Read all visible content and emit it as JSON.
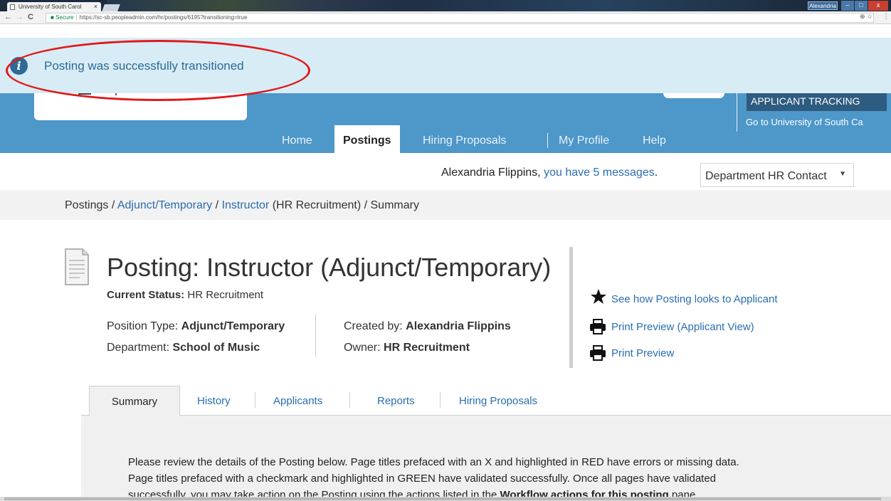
{
  "browser": {
    "tab_title": "University of South Carol",
    "tab_close": "×",
    "secure_label": "Secure",
    "url": "https://sc-sb.peopleadmin.com/hr/postings/6195?transitioning=true",
    "user_badge": "Alexandria",
    "back_glyph": "←",
    "forward_glyph": "→",
    "reload_glyph": "C",
    "lock_glyph": "🔒",
    "right_icons": "⊕ ☆",
    "menu_glyph": "⋮",
    "win_min": "–",
    "win_max": "□",
    "win_close": "x"
  },
  "notification": {
    "icon": "info-icon",
    "icon_glyph": "i",
    "message": "Posting was successfully transitioned"
  },
  "header": {
    "app_tracking": "APPLICANT TRACKING",
    "go_to_link": "Go to University of South Ca",
    "nav": [
      {
        "label": "Home"
      },
      {
        "label": "Postings"
      },
      {
        "label": "Hiring Proposals"
      },
      {
        "label": "My Profile"
      },
      {
        "label": "Help"
      }
    ],
    "active_nav": "Postings"
  },
  "user_bar": {
    "name_text": "Alexandria Flippins, ",
    "messages_link": "you have 5 messages",
    "trailing": ".",
    "role_select": "Department HR Contact",
    "caret": "▼"
  },
  "breadcrumb": {
    "root": "Postings",
    "sep": " / ",
    "level1": "Adjunct/Temporary",
    "level2": "Instructor",
    "level2_suffix": " (HR Recruitment)",
    "current": "Summary"
  },
  "posting": {
    "title": "Posting: Instructor (Adjunct/Temporary)",
    "status_label": "Current Status:",
    "status_value": " HR Recruitment",
    "position_type_label": "Position Type: ",
    "position_type_value": "Adjunct/Temporary",
    "department_label": "Department: ",
    "department_value": "School of Music",
    "created_by_label": "Created by: ",
    "created_by_value": "Alexandria Flippins",
    "owner_label": "Owner: ",
    "owner_value": "HR Recruitment"
  },
  "actions": {
    "see_applicant": "See how Posting looks to Applicant",
    "print_applicant": "Print Preview (Applicant View)",
    "print": "Print Preview",
    "star_icon": "star-icon",
    "printer_icon": "printer-icon"
  },
  "tabs": [
    {
      "label": "Summary",
      "active": true
    },
    {
      "label": "History"
    },
    {
      "label": "Applicants"
    },
    {
      "label": "Reports"
    },
    {
      "label": "Hiring Proposals"
    }
  ],
  "summary_text": {
    "line1": "Please review the details of the Posting below.  Page titles prefaced with an X and highlighted in RED have errors or missing data.",
    "line2": " Page titles prefaced with a checkmark and highlighted in GREEN have validated successfully.  Once all pages have validated",
    "line3_a": "successfully, you may take action on the Posting using the actions listed in the ",
    "line3_b": "Workflow actions for this posting",
    "line3_c": " pane."
  },
  "colors": {
    "header_blue": "#4d97c9",
    "notice_bg": "#d8ecf5",
    "link": "#2a6db0",
    "annotation_red": "#e0191b"
  }
}
